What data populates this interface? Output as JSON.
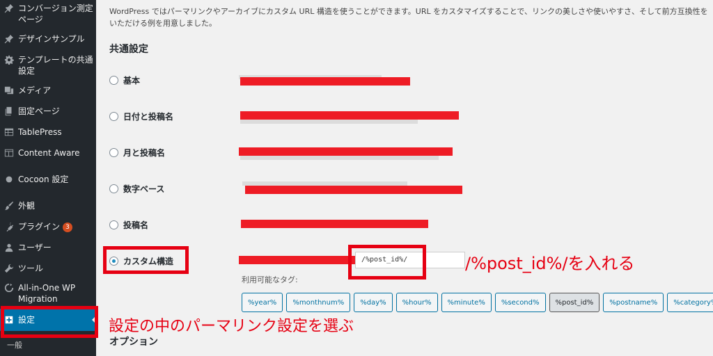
{
  "sidebar": {
    "items": [
      {
        "label": "コンバージョン測定ページ",
        "icon": "pin-icon"
      },
      {
        "label": "デザインサンプル",
        "icon": "pin-icon"
      },
      {
        "label": "テンプレートの共通設定",
        "icon": "gear-icon"
      },
      {
        "label": "メディア",
        "icon": "media-icon"
      },
      {
        "label": "固定ページ",
        "icon": "page-icon"
      },
      {
        "label": "TablePress",
        "icon": "table-icon"
      },
      {
        "label": "Content Aware",
        "icon": "layout-icon"
      },
      {
        "label": "Cocoon 設定",
        "icon": "circle-icon"
      },
      {
        "label": "外観",
        "icon": "brush-icon"
      },
      {
        "label": "プラグイン",
        "icon": "plugin-icon",
        "badge": "3"
      },
      {
        "label": "ユーザー",
        "icon": "user-icon"
      },
      {
        "label": "ツール",
        "icon": "wrench-icon"
      },
      {
        "label": "All-in-One WP Migration",
        "icon": "migration-icon"
      },
      {
        "label": "設定",
        "icon": "settings-icon",
        "active": true
      }
    ],
    "submenu": [
      "一般"
    ]
  },
  "main": {
    "intro": "WordPress ではパーマリンクやアーカイブにカスタム URL 構造を使うことができます。URL をカスタマイズすることで、リンクの美しさや使いやすさ、そして前方互換性を\nいただける例を用意しました。",
    "common_heading": "共通設定",
    "options": [
      {
        "label": "基本",
        "checked": false
      },
      {
        "label": "日付と投稿名",
        "checked": false
      },
      {
        "label": "月と投稿名",
        "checked": false
      },
      {
        "label": "数字ベース",
        "checked": false
      },
      {
        "label": "投稿名",
        "checked": false
      },
      {
        "label": "カスタム構造",
        "checked": true
      }
    ],
    "custom_value": "/%post_id%/",
    "tags_label": "利用可能なタグ:",
    "tags": [
      "%year%",
      "%monthnum%",
      "%day%",
      "%hour%",
      "%minute%",
      "%second%",
      "%post_id%",
      "%postname%",
      "%category%"
    ],
    "active_tag": "%post_id%",
    "options_heading": "オプション"
  },
  "annotations": {
    "custom": "/%post_id%/を入れる",
    "settings": "設定の中のパーマリンク設定を選ぶ"
  },
  "colors": {
    "sidebar_bg": "#23282d",
    "active": "#0073aa",
    "annotation": "#e60012",
    "link": "#0071a1"
  }
}
